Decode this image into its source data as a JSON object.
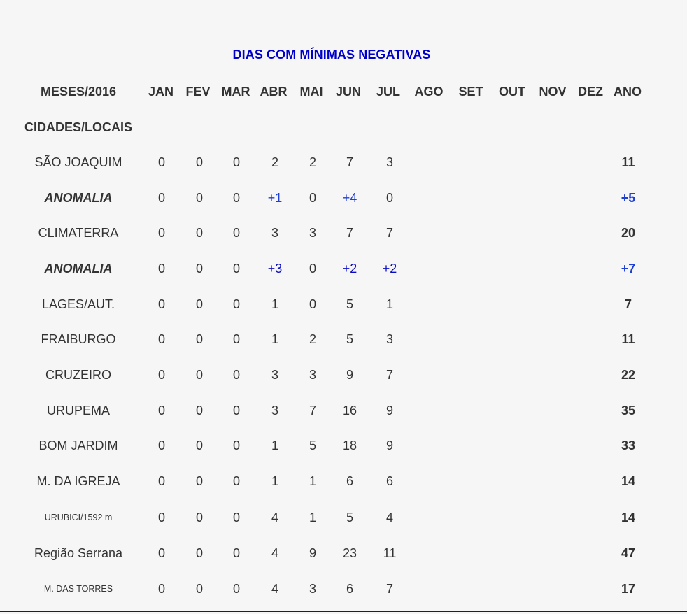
{
  "title": "DIAS COM MÍNIMAS NEGATIVAS",
  "header": {
    "row_label": "MESES/2016",
    "months": [
      "JAN",
      "FEV",
      "MAR",
      "ABR",
      "MAI",
      "JUN",
      "JUL",
      "AGO",
      "SET",
      "OUT",
      "NOV",
      "DEZ",
      "ANO"
    ]
  },
  "subheader": "CIDADES/LOCAIS",
  "rows": [
    {
      "label": "SÃO JOAQUIM",
      "values": [
        "0",
        "0",
        "0",
        "2",
        "2",
        "7",
        "3"
      ],
      "total": "11"
    },
    {
      "label": "ANOMALIA",
      "values": [
        "0",
        "0",
        "0",
        "+1",
        "0",
        "+4",
        "0"
      ],
      "total": "+5"
    },
    {
      "label": "CLIMATERRA",
      "values": [
        "0",
        "0",
        "0",
        "3",
        "3",
        "7",
        "7"
      ],
      "total": "20"
    },
    {
      "label": "ANOMALIA",
      "values": [
        "0",
        "0",
        "0",
        "+3",
        "0",
        "+2",
        "+2"
      ],
      "total": "+7"
    },
    {
      "label": "LAGES/AUT.",
      "values": [
        "0",
        "0",
        "0",
        "1",
        "0",
        "5",
        "1"
      ],
      "total": "7"
    },
    {
      "label": "FRAIBURGO",
      "values": [
        "0",
        "0",
        "0",
        "1",
        "2",
        "5",
        "3"
      ],
      "total": "11"
    },
    {
      "label": "CRUZEIRO",
      "values": [
        "0",
        "0",
        "0",
        "3",
        "3",
        "9",
        "7"
      ],
      "total": "22"
    },
    {
      "label": "URUPEMA",
      "values": [
        "0",
        "0",
        "0",
        "3",
        "7",
        "16",
        "9"
      ],
      "total": "35"
    },
    {
      "label": "BOM JARDIM",
      "values": [
        "0",
        "0",
        "0",
        "1",
        "5",
        "18",
        "9"
      ],
      "total": "33"
    },
    {
      "label": "M. DA IGREJA",
      "values": [
        "0",
        "0",
        "0",
        "1",
        "1",
        "6",
        "6"
      ],
      "total": "14"
    },
    {
      "label": "URUBICI/1592 m",
      "values": [
        "0",
        "0",
        "0",
        "4",
        "1",
        "5",
        "4"
      ],
      "total": "14"
    },
    {
      "label": "Região Serrana",
      "values": [
        "0",
        "0",
        "0",
        "4",
        "9",
        "23",
        "11"
      ],
      "total": "47"
    },
    {
      "label": "M. DAS TORRES",
      "values": [
        "0",
        "0",
        "0",
        "4",
        "3",
        "6",
        "7"
      ],
      "total": "17"
    }
  ],
  "colors": {
    "title": "#0000cc",
    "positive_anomaly": "#1f3fd4",
    "text": "#333333",
    "background": "#f6f6f6"
  }
}
